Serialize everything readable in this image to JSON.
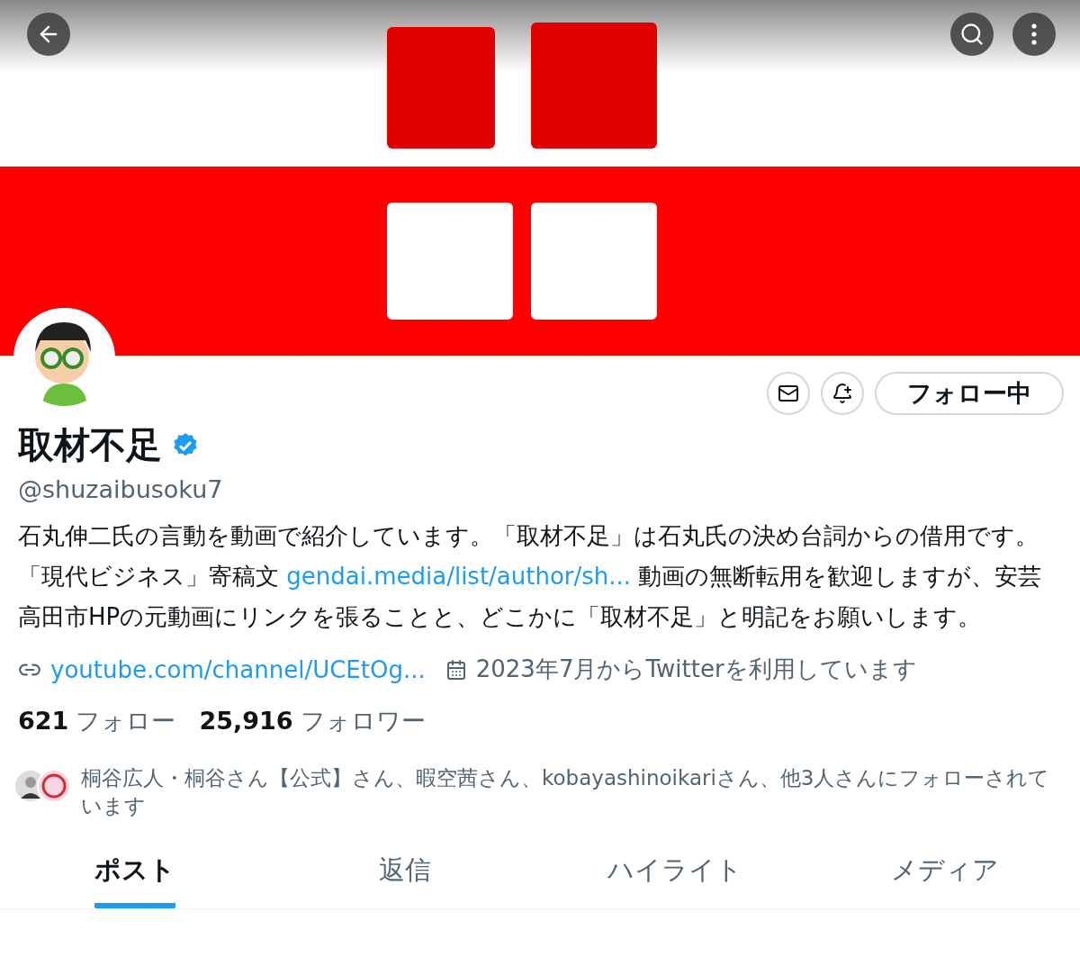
{
  "profile": {
    "name": "取材不足",
    "verified": true,
    "handle": "@shuzaibusoku7",
    "bio_parts": [
      {
        "kind": "text",
        "text": "石丸伸二氏の言動を動画で紹介しています。「取材不足」は石丸氏の決め台詞からの借用です。「現代ビジネス」寄稿文 "
      },
      {
        "kind": "link",
        "text": "gendai.media/list/author/sh..."
      },
      {
        "kind": "text",
        "text": " 動画の無断転用を歓迎しますが、安芸高田市HPの元動画にリンクを張ることと、どこかに「取材不足」と明記をお願いします。"
      }
    ],
    "website": "youtube.com/channel/UCEtOg...",
    "joined": "2023年7月からTwitterを利用しています",
    "following_count": "621",
    "following_label": "フォロー",
    "followers_count": "25,916",
    "followers_label": "フォロワー",
    "followed_by": "桐谷広人・桐谷さん【公式】さん、暇空茜さん、kobayashinoikariさん、他3人さんにフォローされています"
  },
  "follow_button": {
    "label": "フォロー中"
  },
  "tabs": [
    {
      "label": "ポスト",
      "selected": true
    },
    {
      "label": "返信",
      "selected": false
    },
    {
      "label": "ハイライト",
      "selected": false
    },
    {
      "label": "メディア",
      "selected": false
    }
  ]
}
